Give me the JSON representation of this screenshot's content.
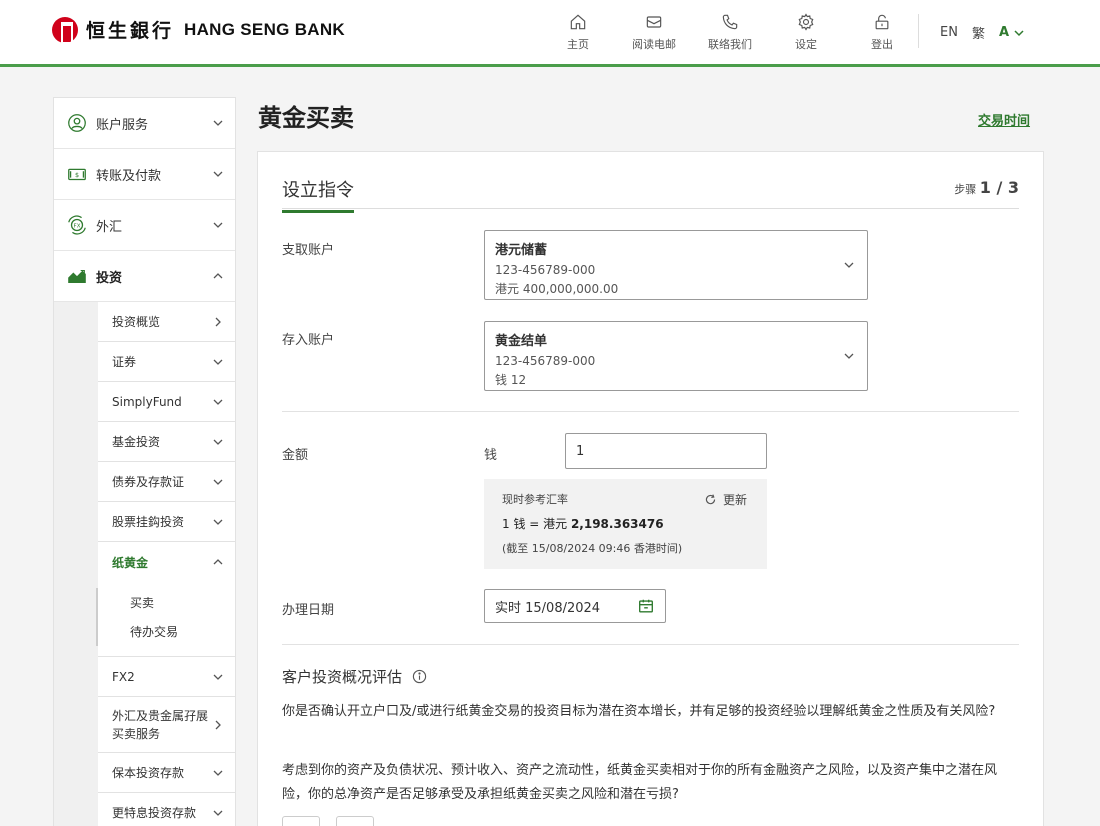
{
  "header": {
    "logo_cn": "恒生銀行",
    "logo_en": "HANG SENG BANK",
    "nav": [
      {
        "label": "主页",
        "icon": "home-icon"
      },
      {
        "label": "阅读电邮",
        "icon": "mail-icon"
      },
      {
        "label": "联络我们",
        "icon": "phone-icon"
      },
      {
        "label": "设定",
        "icon": "gear-icon"
      },
      {
        "label": "登出",
        "icon": "lock-icon"
      }
    ],
    "lang_en": "EN",
    "lang_tc": "繁",
    "font_size": "A"
  },
  "sidebar": {
    "items": [
      {
        "label": "账户服务",
        "icon": "account-icon"
      },
      {
        "label": "转账及付款",
        "icon": "transfer-icon"
      },
      {
        "label": "外汇",
        "icon": "fx-icon"
      },
      {
        "label": "投资",
        "icon": "invest-icon"
      }
    ],
    "sub_items": [
      {
        "label": "投资概览"
      },
      {
        "label": "证券"
      },
      {
        "label": "SimplyFund"
      },
      {
        "label": "基金投资"
      },
      {
        "label": "债券及存款证"
      },
      {
        "label": "股票挂鈎投资"
      },
      {
        "label": "纸黄金"
      },
      {
        "label": "FX2"
      },
      {
        "label": "外汇及贵金属孖展买卖服务"
      },
      {
        "label": "保本投资存款"
      },
      {
        "label": "更特息投资存款"
      }
    ],
    "gold_sub": [
      {
        "label": "买卖"
      },
      {
        "label": "待办交易"
      }
    ]
  },
  "main": {
    "title": "黄金买卖",
    "trade_time": "交易时间",
    "card_title": "设立指令",
    "step_label": "步骤",
    "step_value": "1 / 3",
    "debit_label": "支取账户",
    "debit": {
      "name": "港元储蓄",
      "number": "123-456789-000",
      "balance": "港元 400,000,000.00"
    },
    "credit_label": "存入账户",
    "credit": {
      "name": "黄金结单",
      "number": "123-456789-000",
      "balance": "钱 12"
    },
    "amount_label": "金额",
    "amount_unit": "钱",
    "amount_value": "1",
    "rate_title": "现时参考汇率",
    "rate_refresh": "更新",
    "rate_prefix": "1 钱 = 港元 ",
    "rate_value": "2,198.363476",
    "rate_time": "(截至 15/08/2024 09:46 香港时间)",
    "date_label": "办理日期",
    "date_value": "实时 15/08/2024",
    "assess_title": "客户投资概况评估",
    "q1": "你是否确认开立户口及/或进行纸黄金交易的投资目标为潜在资本增长，并有足够的投资经验以理解纸黄金之性质及有关风险?",
    "q2": "考虑到你的资产及负债状况、预计收入、资产之流动性，纸黄金买卖相对于你的所有金融资产之风险，以及资产集中之潜在风险，你的总净资产是否足够承受及承担纸黄金买卖之风险和潜在亏损?"
  },
  "colors": {
    "accent": "#2f7a2f",
    "brand_red": "#d0021b",
    "header_line": "#4a9d4a"
  }
}
